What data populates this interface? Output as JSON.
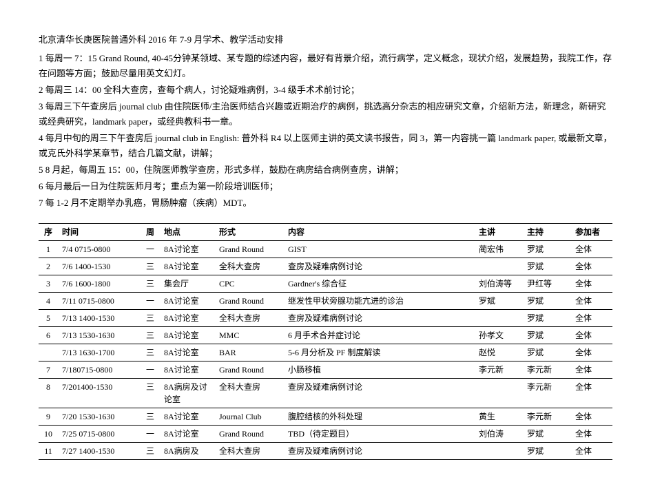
{
  "title": "北京清华长庚医院普通外科 2016 年 7-9 月学术、教学活动安排",
  "notes": [
    "1 每周一 7：15 Grand Round, 40-45分钟某领域、某专题的综述内容，最好有背景介绍，流行病学，定义概念，现状介绍，发展趋势，我院工作，存在问题等方面；鼓励尽量用英文幻灯。",
    "2 每周三 14：00  全科大查房，查每个病人，讨论疑难病例，3-4 级手术术前讨论；",
    "3 每周三下午查房后 journal club  由住院医师/主治医师结合兴趣或近期治疗的病例，挑选高分杂志的相应研究文章，介绍新方法，新理念，新研究或经典研究，landmark paper，或经典教科书一章。",
    "4 每月中旬的周三下午查房后 journal club in English:   普外科 R4 以上医师主讲的英文读书报告，同 3，第一内容挑一篇 landmark paper,  或最新文章，或克氏外科学某章节，结合几篇文献，讲解；",
    "5 8 月起，每周五 15：00，住院医师教学查房，形式多样，鼓励在病房结合病例查房，讲解；",
    "6 每月最后一日为住院医师月考；重点为第一阶段培训医师；",
    "7 每 1-2 月不定期举办乳癌，胃肠肿瘤（疾病）MDT。"
  ],
  "table": {
    "headers": {
      "seq": "序",
      "time": "时间",
      "day": "周",
      "loc": "地点",
      "form": "形式",
      "content": "内容",
      "speaker": "主讲",
      "host": "主持",
      "part": "参加者"
    },
    "rows": [
      {
        "seq": "1",
        "time": "7/4 0715-0800",
        "day": "一",
        "loc": "8A讨论室",
        "form": "Grand Round",
        "content": "GIST",
        "speaker": "蔺宏伟",
        "host": "罗斌",
        "part": "全体"
      },
      {
        "seq": "2",
        "time": "7/6 1400-1530",
        "day": "三",
        "loc": "8A讨论室",
        "form": "全科大查房",
        "content": "查房及疑难病例讨论",
        "speaker": "",
        "host": "罗斌",
        "part": "全体"
      },
      {
        "seq": "3",
        "time": "7/6 1600-1800",
        "day": "三",
        "loc": "集会厅",
        "form": "CPC",
        "content": "Gardner's 综合征",
        "speaker": "刘伯涛等",
        "host": "尹红等",
        "part": "全体"
      },
      {
        "seq": "4",
        "time": "7/11 0715-0800",
        "day": "一",
        "loc": "8A讨论室",
        "form": "Grand Round",
        "content": "继发性甲状旁腺功能亢进的诊治",
        "speaker": "罗斌",
        "host": "罗斌",
        "part": "全体"
      },
      {
        "seq": "5",
        "time": "7/13 1400-1530",
        "day": "三",
        "loc": "8A讨论室",
        "form": "全科大查房",
        "content": "查房及疑难病例讨论",
        "speaker": "",
        "host": "罗斌",
        "part": "全体"
      },
      {
        "seq": "6",
        "time": "7/13 1530-1630",
        "day": "三",
        "loc": "8A讨论室",
        "form": "MMC",
        "content": "6 月手术合并症讨论",
        "speaker": "孙孝文",
        "host": "罗斌",
        "part": "全体"
      },
      {
        "seq": "",
        "time": "7/13 1630-1700",
        "day": "三",
        "loc": "8A讨论室",
        "form": "BAR",
        "content": "5-6 月分析及 PF 制度解读",
        "speaker": "赵悦",
        "host": "罗斌",
        "part": "全体"
      },
      {
        "seq": "7",
        "time": "7/180715-0800",
        "day": "一",
        "loc": "8A讨论室",
        "form": "Grand Round",
        "content": "小肠移植",
        "speaker": "李元新",
        "host": "李元新",
        "part": "全体"
      },
      {
        "seq": "8",
        "time": "7/201400-1530",
        "day": "三",
        "loc": "8A病房及讨论室",
        "form": "全科大查房",
        "content": "查房及疑难病例讨论",
        "speaker": "",
        "host": "李元新",
        "part": "全体"
      },
      {
        "seq": "9",
        "time": "7/20 1530-1630",
        "day": "三",
        "loc": "8A讨论室",
        "form": "Journal Club",
        "content": "腹腔结核的外科处理",
        "speaker": "黄生",
        "host": "李元新",
        "part": "全体"
      },
      {
        "seq": "10",
        "time": "7/25 0715-0800",
        "day": "一",
        "loc": "8A讨论室",
        "form": "Grand Round",
        "content": "TBD（待定题目）",
        "speaker": "刘伯涛",
        "host": "罗斌",
        "part": "全体"
      },
      {
        "seq": "11",
        "time": "7/27 1400-1530",
        "day": "三",
        "loc": "8A病房及",
        "form": "全科大查房",
        "content": "查房及疑难病例讨论",
        "speaker": "",
        "host": "罗斌",
        "part": "全体"
      }
    ]
  }
}
